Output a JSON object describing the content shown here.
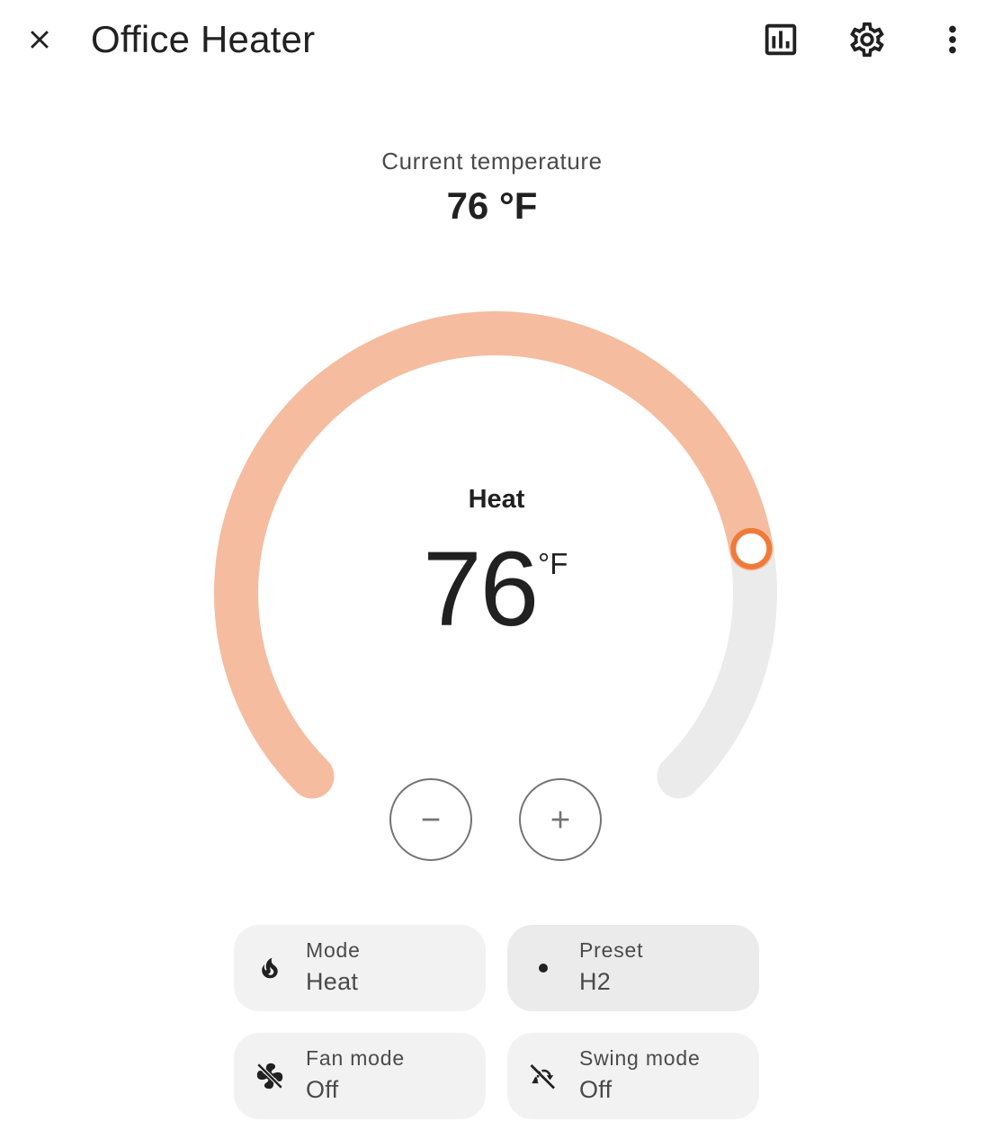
{
  "header": {
    "title": "Office Heater",
    "close_icon": "close-icon",
    "history_icon": "chart-box-icon",
    "settings_icon": "gear-icon",
    "more_icon": "dots-vertical-icon"
  },
  "current": {
    "label": "Current temperature",
    "value": "76 °F"
  },
  "thermostat": {
    "mode": "Heat",
    "target": "76",
    "unit": "°F",
    "setpoint_fraction": 0.797,
    "colors": {
      "active_track": "#f5bc9f",
      "inactive_track": "#ebebeb",
      "handle": "#ef7a3a"
    },
    "decrease_icon": "minus-icon",
    "increase_icon": "plus-icon"
  },
  "tiles": [
    {
      "label": "Mode",
      "value": "Heat",
      "icon": "fire-icon"
    },
    {
      "label": "Preset",
      "value": "H2",
      "icon": "circle-small-icon"
    },
    {
      "label": "Fan mode",
      "value": "Off",
      "icon": "fan-off-icon"
    },
    {
      "label": "Swing mode",
      "value": "Off",
      "icon": "swing-off-icon"
    }
  ]
}
